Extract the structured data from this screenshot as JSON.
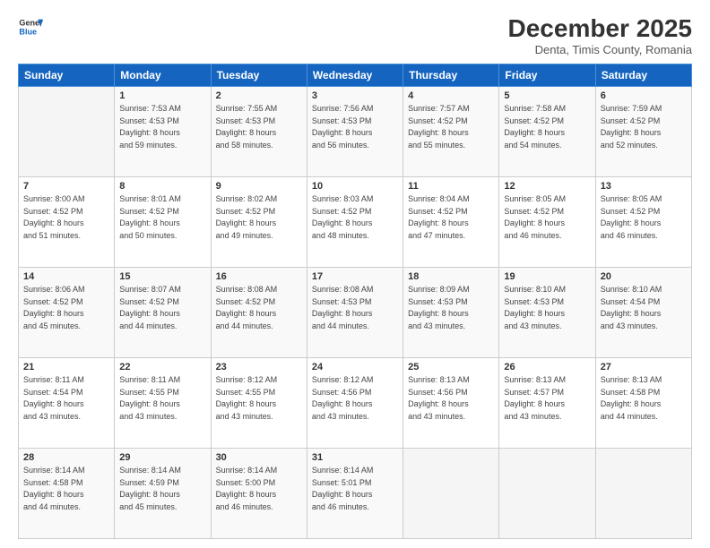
{
  "logo": {
    "line1": "General",
    "line2": "Blue"
  },
  "title": "December 2025",
  "subtitle": "Denta, Timis County, Romania",
  "days_header": [
    "Sunday",
    "Monday",
    "Tuesday",
    "Wednesday",
    "Thursday",
    "Friday",
    "Saturday"
  ],
  "weeks": [
    [
      {
        "num": "",
        "info": ""
      },
      {
        "num": "1",
        "info": "Sunrise: 7:53 AM\nSunset: 4:53 PM\nDaylight: 8 hours\nand 59 minutes."
      },
      {
        "num": "2",
        "info": "Sunrise: 7:55 AM\nSunset: 4:53 PM\nDaylight: 8 hours\nand 58 minutes."
      },
      {
        "num": "3",
        "info": "Sunrise: 7:56 AM\nSunset: 4:53 PM\nDaylight: 8 hours\nand 56 minutes."
      },
      {
        "num": "4",
        "info": "Sunrise: 7:57 AM\nSunset: 4:52 PM\nDaylight: 8 hours\nand 55 minutes."
      },
      {
        "num": "5",
        "info": "Sunrise: 7:58 AM\nSunset: 4:52 PM\nDaylight: 8 hours\nand 54 minutes."
      },
      {
        "num": "6",
        "info": "Sunrise: 7:59 AM\nSunset: 4:52 PM\nDaylight: 8 hours\nand 52 minutes."
      }
    ],
    [
      {
        "num": "7",
        "info": "Sunrise: 8:00 AM\nSunset: 4:52 PM\nDaylight: 8 hours\nand 51 minutes."
      },
      {
        "num": "8",
        "info": "Sunrise: 8:01 AM\nSunset: 4:52 PM\nDaylight: 8 hours\nand 50 minutes."
      },
      {
        "num": "9",
        "info": "Sunrise: 8:02 AM\nSunset: 4:52 PM\nDaylight: 8 hours\nand 49 minutes."
      },
      {
        "num": "10",
        "info": "Sunrise: 8:03 AM\nSunset: 4:52 PM\nDaylight: 8 hours\nand 48 minutes."
      },
      {
        "num": "11",
        "info": "Sunrise: 8:04 AM\nSunset: 4:52 PM\nDaylight: 8 hours\nand 47 minutes."
      },
      {
        "num": "12",
        "info": "Sunrise: 8:05 AM\nSunset: 4:52 PM\nDaylight: 8 hours\nand 46 minutes."
      },
      {
        "num": "13",
        "info": "Sunrise: 8:05 AM\nSunset: 4:52 PM\nDaylight: 8 hours\nand 46 minutes."
      }
    ],
    [
      {
        "num": "14",
        "info": "Sunrise: 8:06 AM\nSunset: 4:52 PM\nDaylight: 8 hours\nand 45 minutes."
      },
      {
        "num": "15",
        "info": "Sunrise: 8:07 AM\nSunset: 4:52 PM\nDaylight: 8 hours\nand 44 minutes."
      },
      {
        "num": "16",
        "info": "Sunrise: 8:08 AM\nSunset: 4:52 PM\nDaylight: 8 hours\nand 44 minutes."
      },
      {
        "num": "17",
        "info": "Sunrise: 8:08 AM\nSunset: 4:53 PM\nDaylight: 8 hours\nand 44 minutes."
      },
      {
        "num": "18",
        "info": "Sunrise: 8:09 AM\nSunset: 4:53 PM\nDaylight: 8 hours\nand 43 minutes."
      },
      {
        "num": "19",
        "info": "Sunrise: 8:10 AM\nSunset: 4:53 PM\nDaylight: 8 hours\nand 43 minutes."
      },
      {
        "num": "20",
        "info": "Sunrise: 8:10 AM\nSunset: 4:54 PM\nDaylight: 8 hours\nand 43 minutes."
      }
    ],
    [
      {
        "num": "21",
        "info": "Sunrise: 8:11 AM\nSunset: 4:54 PM\nDaylight: 8 hours\nand 43 minutes."
      },
      {
        "num": "22",
        "info": "Sunrise: 8:11 AM\nSunset: 4:55 PM\nDaylight: 8 hours\nand 43 minutes."
      },
      {
        "num": "23",
        "info": "Sunrise: 8:12 AM\nSunset: 4:55 PM\nDaylight: 8 hours\nand 43 minutes."
      },
      {
        "num": "24",
        "info": "Sunrise: 8:12 AM\nSunset: 4:56 PM\nDaylight: 8 hours\nand 43 minutes."
      },
      {
        "num": "25",
        "info": "Sunrise: 8:13 AM\nSunset: 4:56 PM\nDaylight: 8 hours\nand 43 minutes."
      },
      {
        "num": "26",
        "info": "Sunrise: 8:13 AM\nSunset: 4:57 PM\nDaylight: 8 hours\nand 43 minutes."
      },
      {
        "num": "27",
        "info": "Sunrise: 8:13 AM\nSunset: 4:58 PM\nDaylight: 8 hours\nand 44 minutes."
      }
    ],
    [
      {
        "num": "28",
        "info": "Sunrise: 8:14 AM\nSunset: 4:58 PM\nDaylight: 8 hours\nand 44 minutes."
      },
      {
        "num": "29",
        "info": "Sunrise: 8:14 AM\nSunset: 4:59 PM\nDaylight: 8 hours\nand 45 minutes."
      },
      {
        "num": "30",
        "info": "Sunrise: 8:14 AM\nSunset: 5:00 PM\nDaylight: 8 hours\nand 46 minutes."
      },
      {
        "num": "31",
        "info": "Sunrise: 8:14 AM\nSunset: 5:01 PM\nDaylight: 8 hours\nand 46 minutes."
      },
      {
        "num": "",
        "info": ""
      },
      {
        "num": "",
        "info": ""
      },
      {
        "num": "",
        "info": ""
      }
    ]
  ]
}
